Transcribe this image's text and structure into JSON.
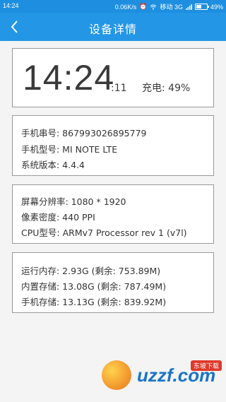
{
  "status_bar": {
    "time": "14:24",
    "network_speed": "0.06K/s",
    "carrier": "移动 3G",
    "battery": "49%",
    "battery_level": 0.49,
    "icons": [
      "alarm-icon",
      "wifi-icon",
      "signal-icon",
      "battery-icon"
    ]
  },
  "header": {
    "title": "设备详情",
    "back_icon": "chevron-left-icon"
  },
  "clock": {
    "hours_minutes": "14:24",
    "seconds": ":11",
    "charge": "充电: 49%"
  },
  "phone_info": {
    "serial": "手机串号: 867993026895779",
    "model": "手机型号: MI NOTE LTE",
    "version": "系统版本: 4.4.4"
  },
  "display_info": {
    "resolution": "屏幕分辨率: 1080 * 1920",
    "density": "像素密度: 440 PPI",
    "cpu": "CPU型号: ARMv7 Processor rev 1 (v7l)"
  },
  "storage_info": {
    "ram": "运行内存: 2.93G  (剩余: 753.89M)",
    "internal": "内置存储: 13.08G  (剩余: 787.49M)",
    "phone": "手机存储: 13.13G  (剩余: 839.92M)"
  },
  "watermark": {
    "text": "uzzf.com",
    "badge": "东坡下载"
  },
  "colors": {
    "accent": "#2396e6",
    "status": "#1e8fe0"
  }
}
